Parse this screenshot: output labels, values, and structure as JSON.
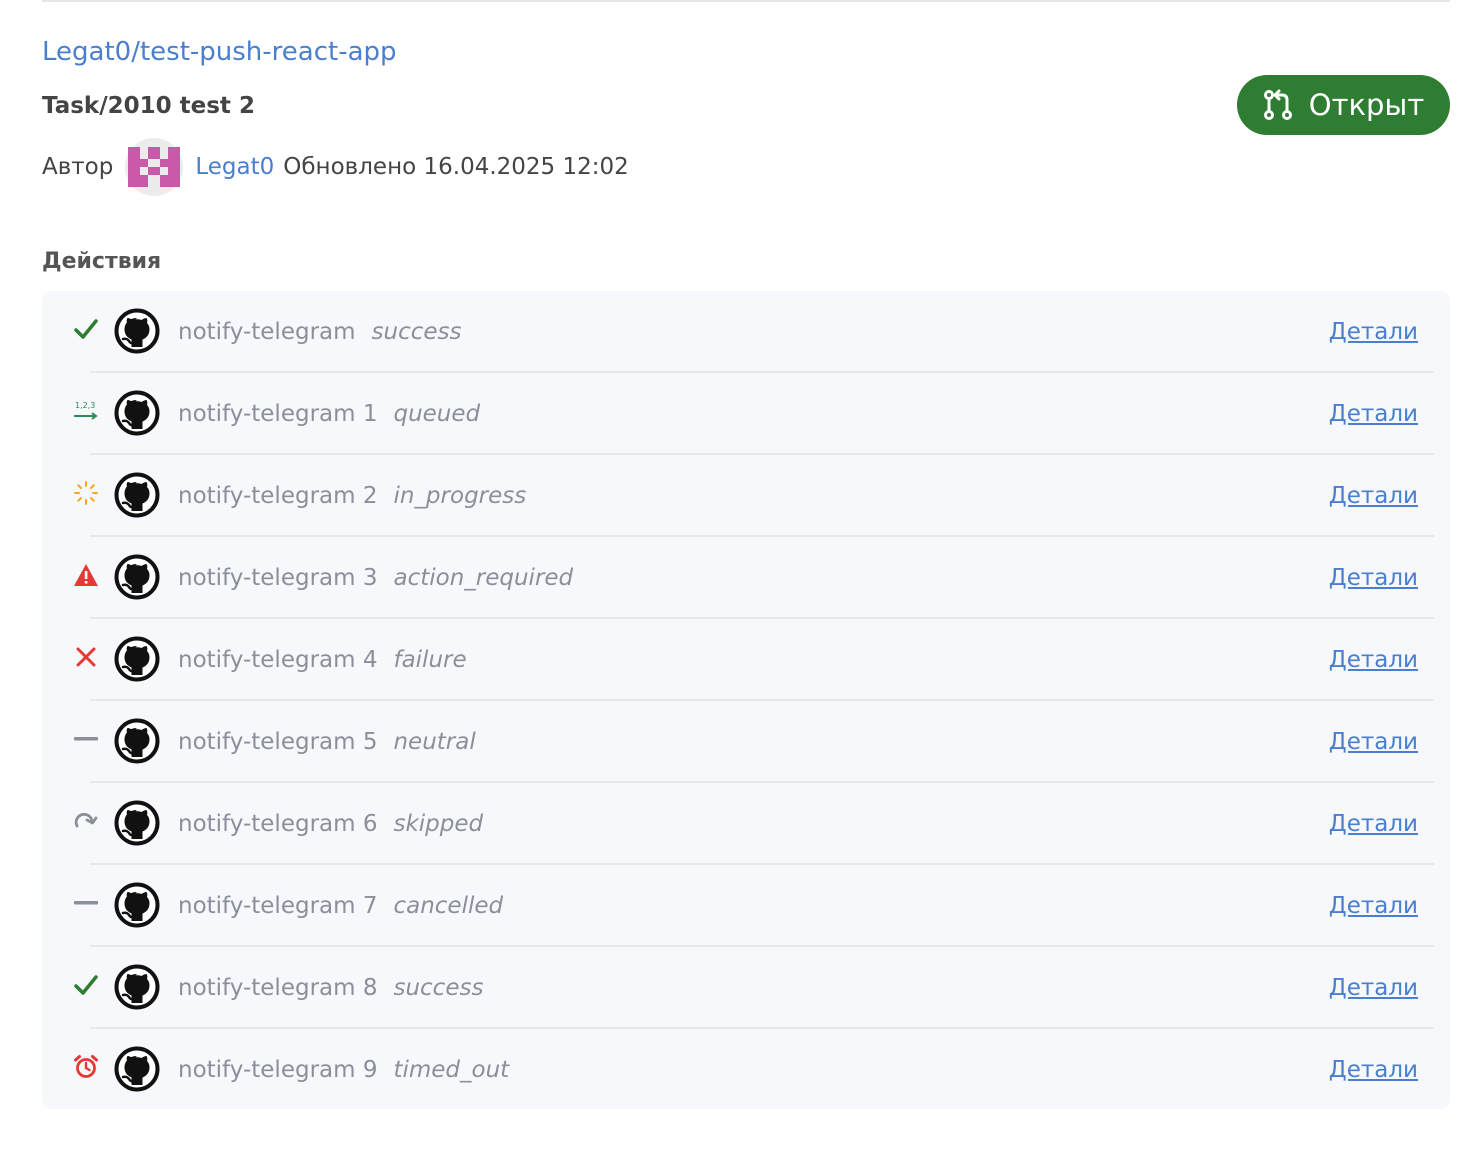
{
  "header": {
    "repo": "Legat0/test-push-react-app",
    "branch": "Task/2010 test 2",
    "author_label": "Автор",
    "author_name": "Legat0",
    "updated_text": "Обновлено 16.04.2025 12:02",
    "open_button_label": "Открыт",
    "open_button_color": "#2f7d32"
  },
  "actions": {
    "title": "Действия",
    "details_label": "Детали",
    "items": [
      {
        "name": "notify-telegram",
        "status": "success",
        "icon": "check-icon"
      },
      {
        "name": "notify-telegram 1",
        "status": "queued",
        "icon": "queue-icon"
      },
      {
        "name": "notify-telegram 2",
        "status": "in_progress",
        "icon": "spinner-icon"
      },
      {
        "name": "notify-telegram 3",
        "status": "action_required",
        "icon": "warning-icon"
      },
      {
        "name": "notify-telegram 4",
        "status": "failure",
        "icon": "cross-icon"
      },
      {
        "name": "notify-telegram 5",
        "status": "neutral",
        "icon": "dash-icon"
      },
      {
        "name": "notify-telegram 6",
        "status": "skipped",
        "icon": "redo-icon"
      },
      {
        "name": "notify-telegram 7",
        "status": "cancelled",
        "icon": "dash-icon"
      },
      {
        "name": "notify-telegram 8",
        "status": "success",
        "icon": "check-icon"
      },
      {
        "name": "notify-telegram 9",
        "status": "timed_out",
        "icon": "alarm-icon"
      }
    ]
  },
  "colors": {
    "link": "#4a7fcf",
    "success": "#2e7d32",
    "failure": "#e53935",
    "in_progress": "#f5a623",
    "queued": "#2e8b57",
    "neutral": "#8a8f99"
  }
}
